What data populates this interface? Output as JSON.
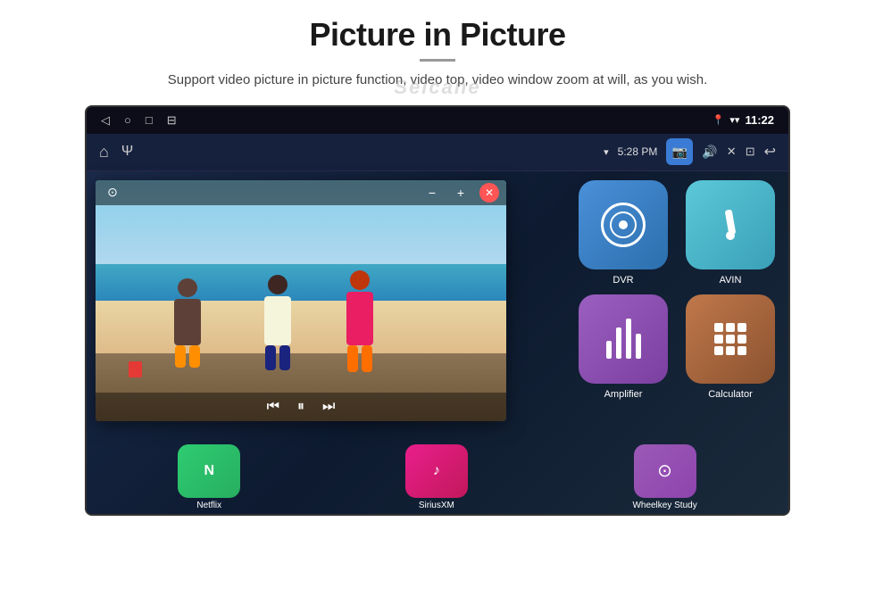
{
  "page": {
    "title": "Picture in Picture",
    "subtitle": "Support video picture in picture function, video top, video window zoom at will, as you wish.",
    "watermark": "Seicane"
  },
  "device": {
    "status_bar": {
      "back_icon": "◁",
      "home_icon": "○",
      "recents_icon": "□",
      "screenshot_icon": "⊟",
      "signal_icon": "▼",
      "wifi_icon": "▾",
      "time": "11:22"
    },
    "action_bar": {
      "home_icon": "⌂",
      "usb_icon": "Ψ",
      "wifi_label": "5:28 PM",
      "camera_icon": "📷",
      "volume_icon": "🔊",
      "close_icon": "✕",
      "window_icon": "⊡",
      "back_icon": "↩"
    },
    "pip": {
      "play_icon": "▶",
      "record_icon": "⊙",
      "minus_icon": "−",
      "plus_icon": "+",
      "close_icon": "✕",
      "prev_icon": "⏮",
      "next_icon": "⏭",
      "pause_icon": "⏸"
    },
    "apps": {
      "top_row": [
        {
          "label": "Netflix",
          "color": "green"
        },
        {
          "label": "SiriusXM",
          "color": "pink"
        },
        {
          "label": "Wheelkey Study",
          "color": "purple"
        }
      ],
      "right_apps": [
        {
          "label": "DVR",
          "color": "dvr",
          "icon": "dvr"
        },
        {
          "label": "AVIN",
          "color": "avin",
          "icon": "avin"
        },
        {
          "label": "Amplifier",
          "color": "amp",
          "icon": "amp"
        },
        {
          "label": "Calculator",
          "color": "calc",
          "icon": "calc"
        }
      ]
    }
  },
  "bottom_apps": [
    {
      "label": "Netflix",
      "color": "#2ecc71"
    },
    {
      "label": "SiriusXM",
      "color": "#e91e8c"
    },
    {
      "label": "Wheelkey Study",
      "color": "#9b59b6"
    },
    {
      "label": "Amplifier",
      "color": "#9b5fc0"
    },
    {
      "label": "Calculator",
      "color": "#c0784a"
    }
  ]
}
